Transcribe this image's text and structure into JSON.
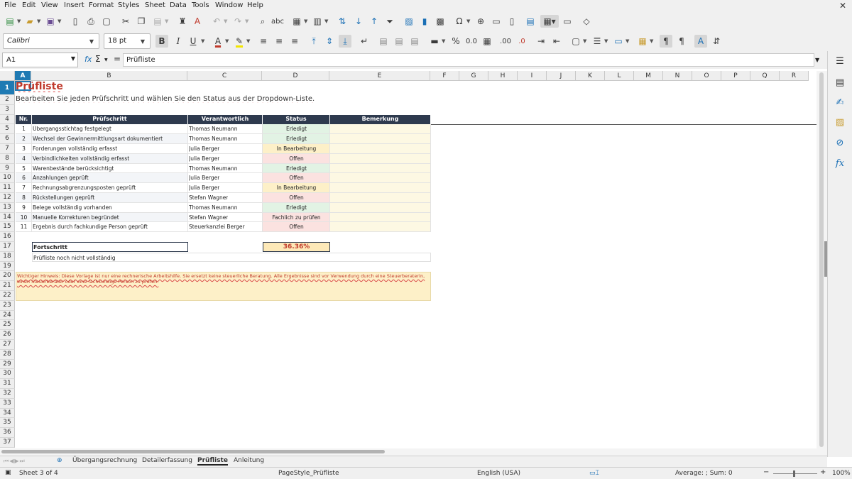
{
  "menu": [
    "File",
    "Edit",
    "View",
    "Insert",
    "Format",
    "Styles",
    "Sheet",
    "Data",
    "Tools",
    "Window",
    "Help"
  ],
  "toolbar": {
    "font_name": "Calibri",
    "font_size": "18 pt"
  },
  "formula_bar": {
    "cell_ref": "A1",
    "fx_symbol": "fx",
    "sum_symbol": "Σ",
    "equals_symbol": "=",
    "content": "Prüfliste"
  },
  "columns": [
    "A",
    "B",
    "C",
    "D",
    "E",
    "F",
    "G",
    "H",
    "I",
    "J",
    "K",
    "L",
    "M",
    "N",
    "O",
    "P",
    "Q",
    "R"
  ],
  "rows": [
    "1",
    "2",
    "3",
    "4",
    "5",
    "6",
    "7",
    "8",
    "9",
    "10",
    "11",
    "12",
    "13",
    "14",
    "15",
    "16",
    "17",
    "18",
    "19",
    "20",
    "21",
    "22",
    "23",
    "24",
    "25",
    "26",
    "27",
    "28",
    "29",
    "30",
    "31",
    "32",
    "33",
    "34",
    "35",
    "36",
    "37"
  ],
  "sheet": {
    "title": "Prüfliste",
    "subtitle": "Bearbeiten Sie jeden Prüfschritt und wählen Sie den Status aus der Dropdown-Liste.",
    "table_headers": [
      "Nr.",
      "Prüfschritt",
      "Verantwortlich",
      "Status",
      "Bemerkung"
    ],
    "rows": [
      {
        "nr": "1",
        "step": "Übergangsstichtag festgelegt",
        "owner": "Thomas Neumann",
        "status": "Erledigt",
        "status_color": "#e2f3e4"
      },
      {
        "nr": "2",
        "step": "Wechsel der Gewinnermittlungsart dokumentiert",
        "owner": "Thomas Neumann",
        "status": "Erledigt",
        "status_color": "#e2f3e4"
      },
      {
        "nr": "3",
        "step": "Forderungen vollständig erfasst",
        "owner": "Julia Berger",
        "status": "In Bearbeitung",
        "status_color": "#fdf0c8"
      },
      {
        "nr": "4",
        "step": "Verbindlichkeiten vollständig erfasst",
        "owner": "Julia Berger",
        "status": "Offen",
        "status_color": "#fbe2e0"
      },
      {
        "nr": "5",
        "step": "Warenbestände berücksichtigt",
        "owner": "Thomas Neumann",
        "status": "Erledigt",
        "status_color": "#e2f3e4"
      },
      {
        "nr": "6",
        "step": "Anzahlungen geprüft",
        "owner": "Julia Berger",
        "status": "Offen",
        "status_color": "#fbe2e0"
      },
      {
        "nr": "7",
        "step": "Rechnungsabgrenzungsposten geprüft",
        "owner": "Julia Berger",
        "status": "In Bearbeitung",
        "status_color": "#fdf0c8"
      },
      {
        "nr": "8",
        "step": "Rückstellungen geprüft",
        "owner": "Stefan Wagner",
        "status": "Offen",
        "status_color": "#fbe2e0"
      },
      {
        "nr": "9",
        "step": "Belege vollständig vorhanden",
        "owner": "Thomas Neumann",
        "status": "Erledigt",
        "status_color": "#e2f3e4"
      },
      {
        "nr": "10",
        "step": "Manuelle Korrekturen begründet",
        "owner": "Stefan Wagner",
        "status": "Fachlich zu prüfen",
        "status_color": "#fbe2e0"
      },
      {
        "nr": "11",
        "step": "Ergebnis durch fachkundige Person geprüft",
        "owner": "Steuerkanzlei Berger",
        "status": "Offen",
        "status_color": "#fbe2e0"
      }
    ],
    "progress_label": "Fortschritt",
    "progress_value": "36.36%",
    "progress_note": "Prüfliste noch nicht vollständig",
    "notice": "Wichtiger Hinweis: Diese Vorlage ist nur eine rechnerische Arbeitshilfe. Sie ersetzt keine steuerliche Beratung. Alle Ergebnisse sind vor Verwendung durch eine Steuerberaterin, einen Steuerberater oder eine fachkundige Person zu prüfen."
  },
  "tabs": [
    "Übergangsrechnung",
    "Detailerfassung",
    "Prüfliste",
    "Anleitung"
  ],
  "active_tab": "Prüfliste",
  "status_bar": {
    "sheet_info": "Sheet 3 of 4",
    "page_style": "PageStyle_Prüfliste",
    "language": "English (USA)",
    "stats": "Average: ; Sum: 0",
    "zoom": "100%"
  },
  "colors": {
    "header_fill": "#2e3a4e",
    "title_color": "#c0392b",
    "selection": "#1f7ab3",
    "progress_fill": "#fde9b8",
    "notice_fill": "#fdf0c8",
    "remark_fill": "#fdf8e3"
  },
  "icons": [
    "new-icon",
    "open-icon",
    "save-icon",
    "export-pdf-icon",
    "print-icon",
    "print-preview-icon",
    "cut-icon",
    "copy-icon",
    "paste-icon",
    "clone-format-icon",
    "clear-format-icon",
    "undo-icon",
    "redo-icon",
    "find-replace-icon",
    "spelling-icon",
    "row-icon",
    "column-icon",
    "sort-icon",
    "sort-ascending-icon",
    "sort-descending-icon",
    "autofilter-icon",
    "image-icon",
    "chart-icon",
    "pivot-table-icon",
    "special-character-icon",
    "hyperlink-icon",
    "comment-icon",
    "headers-footers-icon",
    "define-print-area-icon",
    "freeze-icon",
    "split-window-icon",
    "show-draw-icon"
  ]
}
